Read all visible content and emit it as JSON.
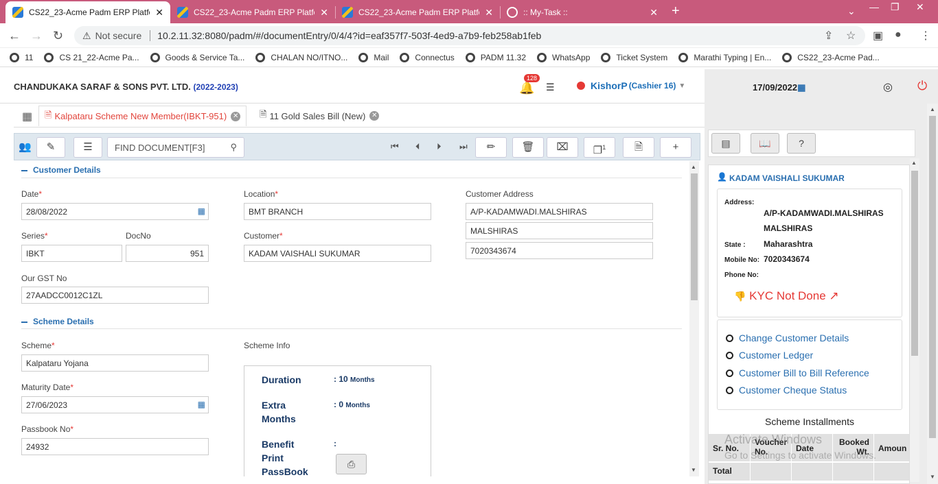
{
  "browser": {
    "tabs": [
      {
        "title": "CS22_23-Acme Padm ERP Platfor"
      },
      {
        "title": "CS22_23-Acme Padm ERP Platfor"
      },
      {
        "title": "CS22_23-Acme Padm ERP Platfor"
      },
      {
        "title": ":: My-Task ::"
      }
    ],
    "not_secure": "Not secure",
    "url": "10.2.11.32:8080/padm/#/documentEntry/0/4/4?id=eaf357f7-503f-4ed9-a7b9-feb258ab1feb",
    "bookmarks": [
      "11",
      "CS 21_22-Acme Pa...",
      "Goods & Service Ta...",
      "CHALAN NO/ITNO...",
      "Mail",
      "Connectus",
      "PADM 11.32",
      "WhatsApp",
      "Ticket System",
      "Marathi Typing | En...",
      "CS22_23-Acme Pad..."
    ]
  },
  "header": {
    "company": "CHANDUKAKA SARAF & SONS PVT. LTD.",
    "year": "(2022-2023)",
    "notifications": "128",
    "user": "KishorP",
    "role": "(Cashier 16)",
    "date": "17/09/2022"
  },
  "doc_tabs": [
    {
      "label": "Kalpataru Scheme New Member(IBKT-951)"
    },
    {
      "label": "11 Gold Sales Bill (New)"
    }
  ],
  "toolbar": {
    "find_placeholder": "FIND DOCUMENT[F3]",
    "pagination_badge": "1"
  },
  "customer_details": {
    "section": "Customer Details",
    "date_label": "Date",
    "date": "28/08/2022",
    "location_label": "Location",
    "location": "BMT BRANCH",
    "address_label": "Customer Address",
    "address1": "A/P-KADAMWADI.MALSHIRAS",
    "address2": "MALSHIRAS",
    "address3": "7020343674",
    "series_label": "Series",
    "series": "IBKT",
    "docno_label": "DocNo",
    "docno": "951",
    "customer_label": "Customer",
    "customer": "KADAM VAISHALI SUKUMAR",
    "gst_label": "Our GST No",
    "gst": "27AADCC0012C1ZL"
  },
  "scheme_details": {
    "section": "Scheme Details",
    "scheme_label": "Scheme",
    "scheme": "Kalpataru Yojana",
    "scheme_info_label": "Scheme Info",
    "maturity_label": "Maturity Date",
    "maturity": "27/06/2023",
    "passbook_label": "Passbook No",
    "passbook": "24932",
    "info": {
      "duration_label": "Duration",
      "duration_value": ": 10",
      "duration_unit": "Months",
      "extra_label1": "Extra",
      "extra_label2": "Months",
      "extra_value": ": 0",
      "extra_unit": "Months",
      "benefit_label": "Benefit",
      "benefit_value": ":",
      "print_label": "Print",
      "passbook_label": "PassBook"
    }
  },
  "right_panel": {
    "customer_name": "KADAM VAISHALI SUKUMAR",
    "address_label": "Address:",
    "address1": "A/P-KADAMWADI.MALSHIRAS",
    "address2": "MALSHIRAS",
    "state_label": "State :",
    "state": "Maharashtra",
    "mobile_label": "Mobile No:",
    "mobile": "7020343674",
    "phone_label": "Phone No:",
    "kyc": "KYC Not Done",
    "links": [
      "Change Customer Details",
      "Customer Ledger",
      "Customer Bill to Bill Reference",
      "Customer Cheque Status"
    ],
    "installments_title": "Scheme Installments",
    "columns": [
      "Sr. No.",
      "Voucher No.",
      "Date",
      "Booked Wt.",
      "Amoun"
    ],
    "total_label": "Total",
    "watermark1": "Activate Windows",
    "watermark2": "Go to Settings to activate Windows."
  },
  "colors": {
    "tab_bar": "#c85a7c",
    "accent": "#2a6fb0",
    "danger": "#e53935"
  }
}
